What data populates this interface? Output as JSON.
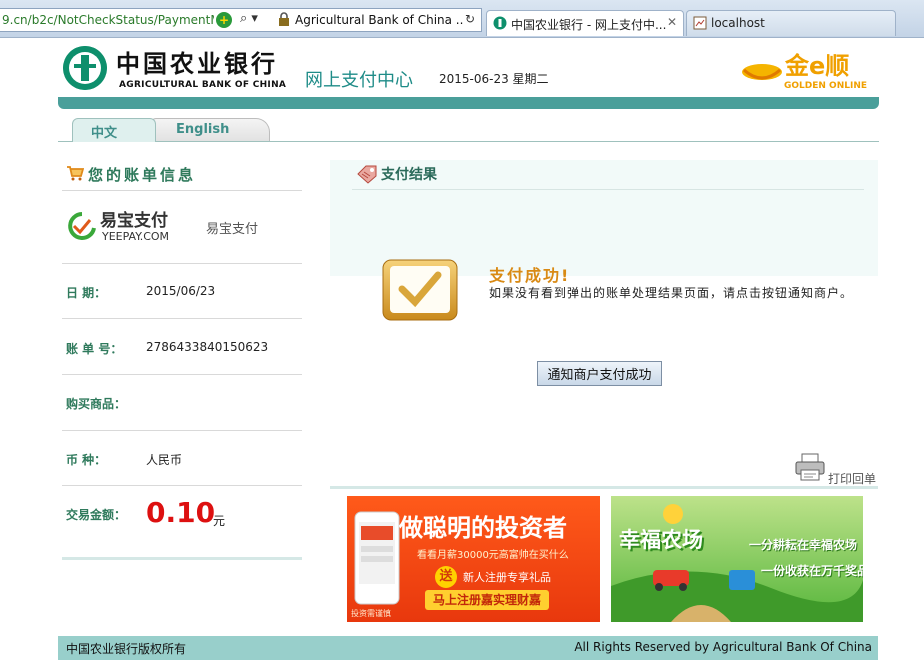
{
  "browser": {
    "address_url": "9.cn/b2c/NotCheckStatus/PaymentM",
    "address_site": "Agricultural Bank of China ...",
    "tabs": [
      {
        "label": "中国农业银行 - 网上支付中...",
        "active": true
      },
      {
        "label": "localhost",
        "active": false
      }
    ]
  },
  "header": {
    "logo_cn": "中国农业银行",
    "logo_en": "AGRICULTURAL BANK OF CHINA",
    "title": "网上支付中心",
    "date": "2015-06-23 星期二",
    "golden_logo_cn": "金e顺",
    "golden_logo_en": "GOLDEN ONLINE"
  },
  "lang_tabs": {
    "chinese": "中文",
    "english": "English"
  },
  "bill": {
    "title": "您的账单信息",
    "merchant_logo_cn": "易宝支付",
    "merchant_logo_en": "YEEPAY.COM",
    "merchant_name": "易宝支付",
    "rows": [
      {
        "label": "日    期：",
        "value": "2015/06/23"
      },
      {
        "label": "账 单 号：",
        "value": "2786433840150623"
      },
      {
        "label": "购买商品：",
        "value": ""
      },
      {
        "label": "币    种：",
        "value": "人民币"
      }
    ],
    "amount_label": "交易金额：",
    "amount_value": "0.10",
    "amount_unit": "元"
  },
  "result": {
    "title": "支付结果",
    "success_title": "支付成功!",
    "success_desc": "如果没有看到弹出的账单处理结果页面，请点击按钮通知商户。",
    "notify_button": "通知商户支付成功",
    "print_link": "打印回单"
  },
  "banners": {
    "invest": {
      "headline": "做聪明的投资者",
      "line1": "看看月薪30000元高富帅在买什么",
      "gift_char": "送",
      "line2": "新人注册专享礼品",
      "button": "马上注册嘉实理财嘉",
      "corner": "投资需谨慎"
    },
    "farm": {
      "headline": "幸福农场",
      "line1": "一分耕耘在幸福农场",
      "line2": "一份收获在万千奖品"
    }
  },
  "footer": {
    "left": "中国农业银行版权所有",
    "right": "All Rights Reserved by Agricultural Bank Of China"
  },
  "colors": {
    "brand_teal": "#4a9f9a",
    "brand_green": "#0e8f6c",
    "amount_red": "#dd1010",
    "success_orange": "#d98a14",
    "footer_bg": "#98cfcb"
  }
}
